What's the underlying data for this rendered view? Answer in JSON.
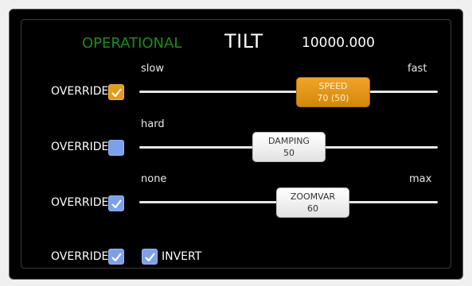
{
  "header": {
    "status": "OPERATIONAL",
    "title": "TILT",
    "value": "10000.000"
  },
  "colors": {
    "status_green": "#1a8c1a",
    "accent_orange": "#e29a1d",
    "checkbox_blue": "#7da0ea"
  },
  "rows": [
    {
      "override_label": "OVERRIDE",
      "override_checked": true,
      "override_style": "orange",
      "min_label": "slow",
      "max_label": "fast",
      "slider_name": "SPEED",
      "slider_value": "70 (50)"
    },
    {
      "override_label": "OVERRIDE",
      "override_checked": false,
      "override_style": "blue",
      "min_label": "hard",
      "slider_name": "DAMPING",
      "slider_value": "50"
    },
    {
      "override_label": "OVERRIDE",
      "override_checked": true,
      "override_style": "blue",
      "min_label": "none",
      "max_label": "max",
      "slider_name": "ZOOMVAR",
      "slider_value": "60"
    }
  ],
  "bottom": {
    "override_label": "OVERRIDE",
    "override_checked": true,
    "invert_label": "INVERT",
    "invert_checked": true
  }
}
